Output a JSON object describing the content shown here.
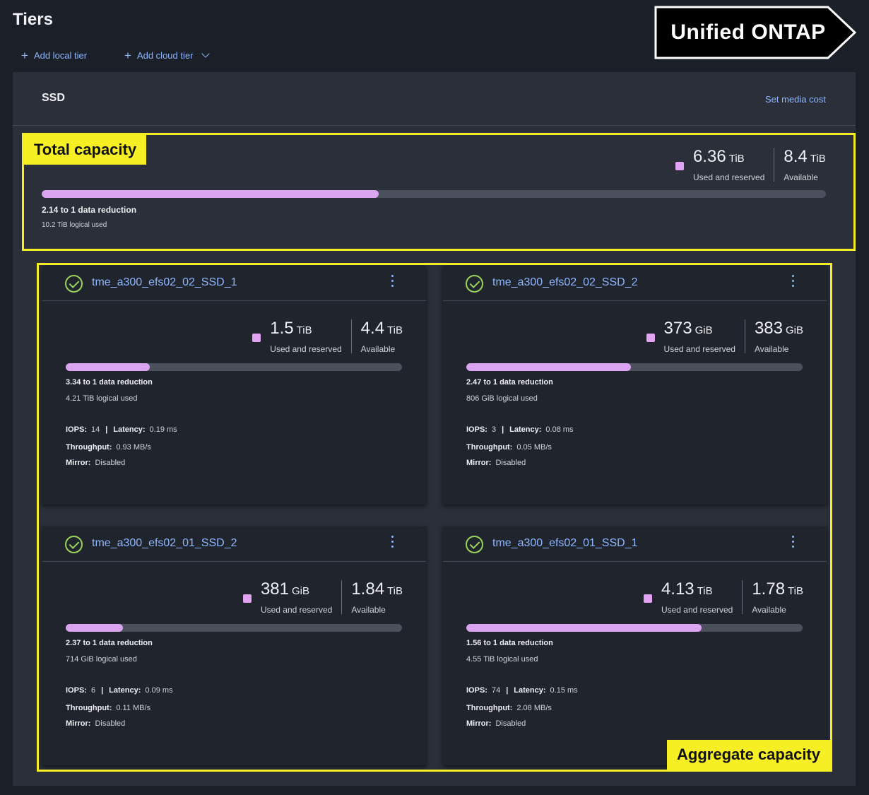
{
  "page": {
    "title": "Tiers"
  },
  "actions": {
    "add_local": "Add local tier",
    "add_cloud": "Add cloud tier"
  },
  "banner": {
    "text": "Unified ONTAP"
  },
  "panel": {
    "title": "SSD",
    "set_media_cost": "Set media cost"
  },
  "annotations": {
    "total": "Total capacity",
    "aggregate": "Aggregate capacity"
  },
  "total": {
    "used_value": "6.36",
    "used_unit": "TiB",
    "used_label": "Used and reserved",
    "avail_value": "8.4",
    "avail_unit": "TiB",
    "avail_label": "Available",
    "fill_fraction": 0.43,
    "reduction": "2.14 to 1 data reduction",
    "logical": "10.2 TiB logical used"
  },
  "labels": {
    "iops": "IOPS:",
    "latency": "Latency:",
    "throughput": "Throughput:",
    "mirror": "Mirror:"
  },
  "aggregates": [
    {
      "name": "tme_a300_efs02_02_SSD_1",
      "used_value": "1.5",
      "used_unit": "TiB",
      "used_label": "Used and reserved",
      "avail_value": "4.4",
      "avail_unit": "TiB",
      "avail_label": "Available",
      "fill_fraction": 0.25,
      "reduction": "3.34 to 1 data reduction",
      "logical": "4.21 TiB logical used",
      "iops": "14",
      "latency": "0.19 ms",
      "throughput": "0.93 MB/s",
      "mirror": "Disabled"
    },
    {
      "name": "tme_a300_efs02_02_SSD_2",
      "used_value": "373",
      "used_unit": "GiB",
      "used_label": "Used and reserved",
      "avail_value": "383",
      "avail_unit": "GiB",
      "avail_label": "Available",
      "fill_fraction": 0.49,
      "reduction": "2.47 to 1 data reduction",
      "logical": "806 GiB logical used",
      "iops": "3",
      "latency": "0.08 ms",
      "throughput": "0.05 MB/s",
      "mirror": "Disabled"
    },
    {
      "name": "tme_a300_efs02_01_SSD_2",
      "used_value": "381",
      "used_unit": "GiB",
      "used_label": "Used and reserved",
      "avail_value": "1.84",
      "avail_unit": "TiB",
      "avail_label": "Available",
      "fill_fraction": 0.17,
      "reduction": "2.37 to 1 data reduction",
      "logical": "714 GiB logical used",
      "iops": "6",
      "latency": "0.09 ms",
      "throughput": "0.11 MB/s",
      "mirror": "Disabled"
    },
    {
      "name": "tme_a300_efs02_01_SSD_1",
      "used_value": "4.13",
      "used_unit": "TiB",
      "used_label": "Used and reserved",
      "avail_value": "1.78",
      "avail_unit": "TiB",
      "avail_label": "Available",
      "fill_fraction": 0.7,
      "reduction": "1.56 to 1 data reduction",
      "logical": "4.55 TiB logical used",
      "iops": "74",
      "latency": "0.15 ms",
      "throughput": "2.08 MB/s",
      "mirror": "Disabled"
    }
  ]
}
